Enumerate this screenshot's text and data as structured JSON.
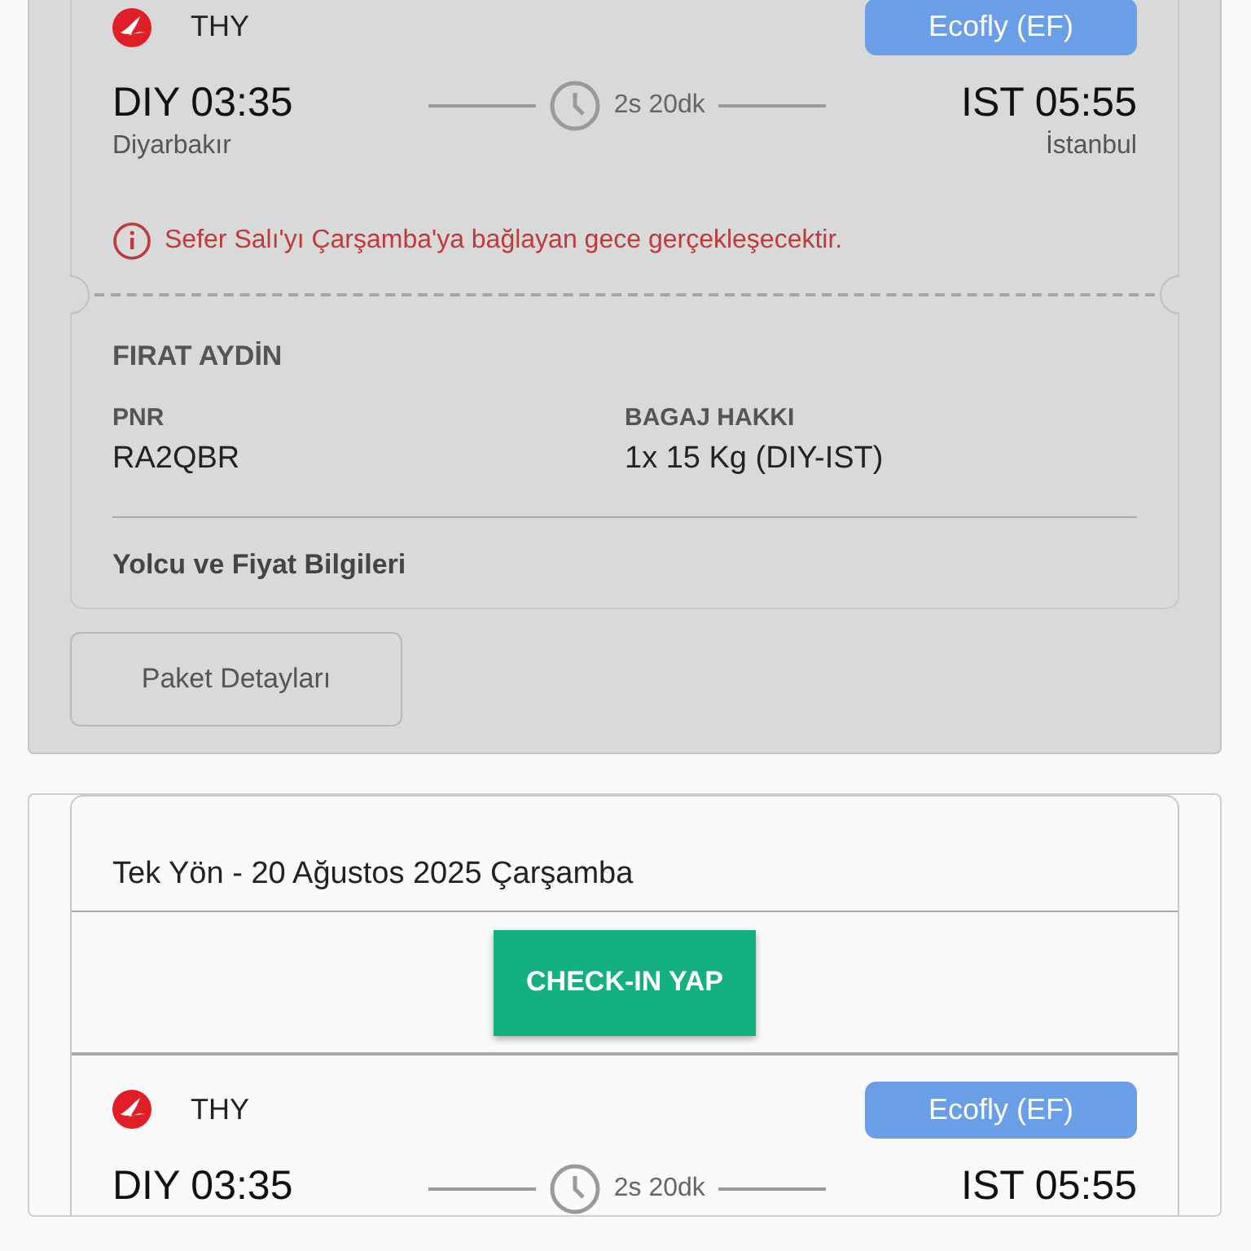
{
  "bookings": [
    {
      "dimmed": true,
      "segment": {
        "airline": "THY",
        "fare_class": "Ecofly (EF)",
        "departure": {
          "code_time": "DIY 03:35",
          "city": "Diyarbakır"
        },
        "duration": "2s 20dk",
        "arrival": {
          "code_time": "IST 05:55",
          "city": "İstanbul"
        }
      },
      "notice": "Sefer Salı'yı Çarşamba'ya bağlayan gece gerçekleşecektir.",
      "passenger": {
        "name": "FIRAT AYDİN",
        "pnr_label": "PNR",
        "pnr": "RA2QBR",
        "baggage_label": "BAGAJ HAKKI",
        "baggage": "1x 15 Kg (DIY-IST)"
      },
      "details_link": "Yolcu ve Fiyat Bilgileri",
      "package_button": "Paket Detayları"
    },
    {
      "dimmed": false,
      "trip_title": "Tek Yön - 20 Ağustos 2025 Çarşamba",
      "checkin_button": "CHECK-IN YAP",
      "segment": {
        "airline": "THY",
        "fare_class": "Ecofly (EF)",
        "departure": {
          "code_time": "DIY 03:35"
        },
        "duration": "2s 20dk",
        "arrival": {
          "code_time": "IST 05:55"
        }
      }
    }
  ]
}
